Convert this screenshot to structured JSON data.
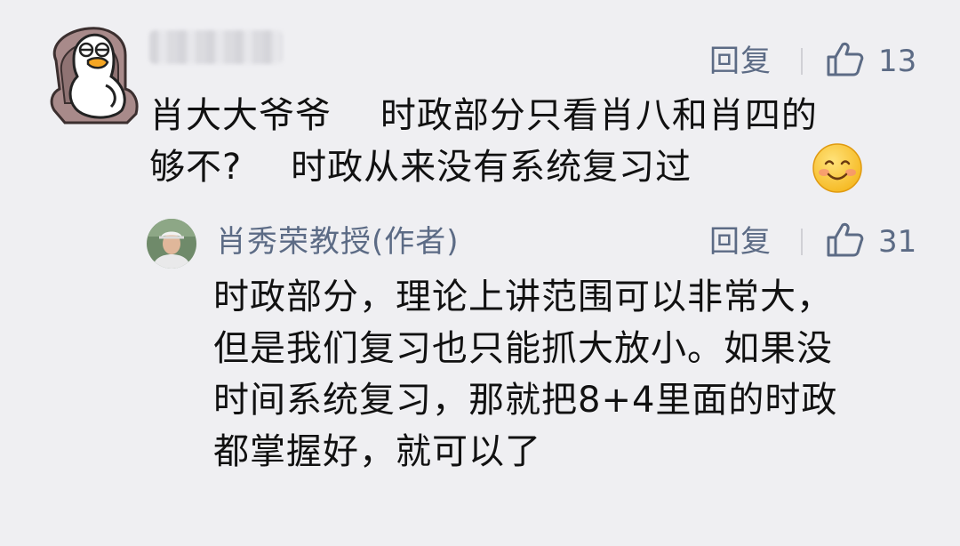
{
  "comment": {
    "reply_label": "回复",
    "like_count": "13",
    "text_line1": "肖大大爷爷    时政部分只看肖八和肖四的",
    "text_line2": "够不?    时政从来没有系统复习过",
    "emoji_icon": "smiling-face-emoji"
  },
  "reply": {
    "author": "肖秀荣教授(作者)",
    "reply_label": "回复",
    "like_count": "31",
    "lines": [
      "时政部分，理论上讲范围可以非常大，",
      "但是我们复习也只能抓大放小。如果没",
      "时间系统复习，那就把8+4里面的时政",
      "都掌握好，就可以了"
    ]
  },
  "colors": {
    "background": "#efeff2",
    "action": "#5c6b85",
    "text": "#111111"
  }
}
